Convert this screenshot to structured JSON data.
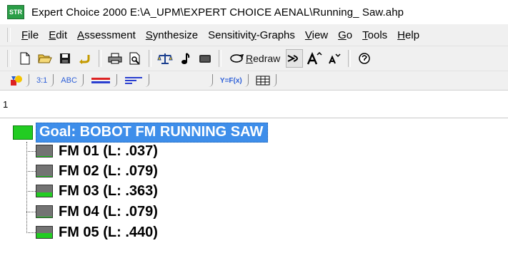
{
  "window": {
    "app_icon_text": "STR",
    "title": "Expert Choice 2000     E:\\A_UPM\\EXPERT CHOICE AENAL\\Running_ Saw.ahp"
  },
  "menu": {
    "items": [
      {
        "underline": "F",
        "rest": "ile"
      },
      {
        "underline": "E",
        "rest": "dit"
      },
      {
        "underline": "A",
        "rest": "ssessment"
      },
      {
        "underline": "S",
        "rest": "ynthesize"
      },
      {
        "pre": "Sensitivit",
        "underline": "y",
        "rest": "-Graphs"
      },
      {
        "underline": "V",
        "rest": "iew"
      },
      {
        "underline": "G",
        "rest": "o"
      },
      {
        "underline": "T",
        "rest": "ools"
      },
      {
        "underline": "H",
        "rest": "elp"
      }
    ]
  },
  "toolbar": {
    "redraw_underline": "R",
    "redraw_rest": "edraw"
  },
  "tabs": {
    "ratio": "3:1",
    "abc": "ABC",
    "yfx": "Y=F(x)"
  },
  "node_path": "1",
  "tree": {
    "goal": "Goal: BOBOT FM RUNNING SAW",
    "goal_color": "#22cc22",
    "goal_highlight": "#3e8eea",
    "nodes": [
      {
        "label": "FM 01 (L: .037)",
        "priority": 0.037
      },
      {
        "label": "FM 02 (L: .079)",
        "priority": 0.079
      },
      {
        "label": "FM 03 (L: .363)",
        "priority": 0.363
      },
      {
        "label": "FM 04 (L: .079)",
        "priority": 0.079
      },
      {
        "label": "FM 05 (L: .440)",
        "priority": 0.44
      }
    ]
  }
}
